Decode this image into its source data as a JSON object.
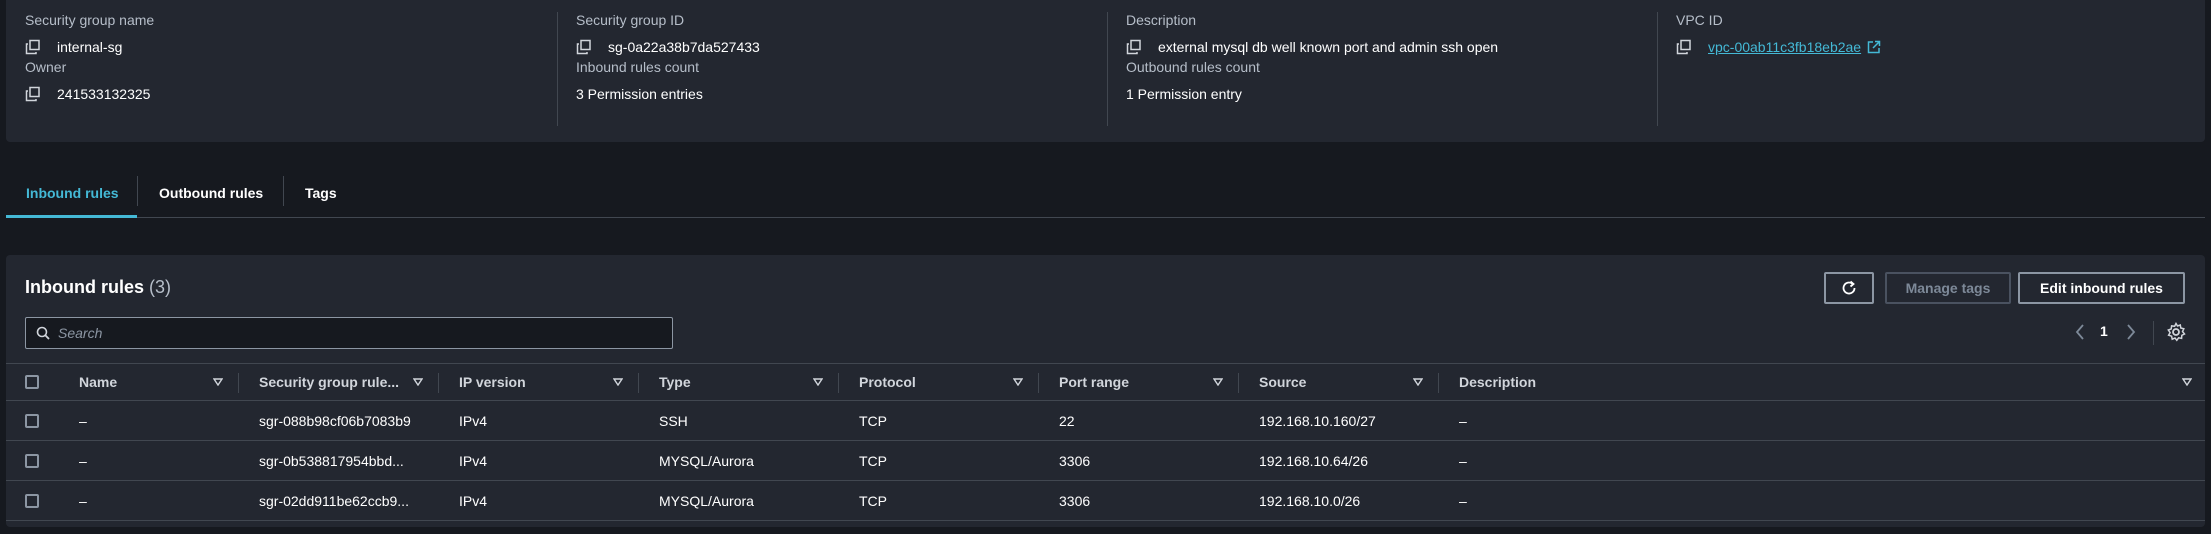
{
  "details": {
    "sg_name": {
      "label": "Security group name",
      "value": "internal-sg"
    },
    "sg_id": {
      "label": "Security group ID",
      "value": "sg-0a22a38b7da527433"
    },
    "description": {
      "label": "Description",
      "value": "external mysql db well known port and admin ssh open"
    },
    "vpc_id": {
      "label": "VPC ID",
      "value": "vpc-00ab11c3fb18eb2ae"
    },
    "owner": {
      "label": "Owner",
      "value": "241533132325"
    },
    "inbound_count": {
      "label": "Inbound rules count",
      "value": "3 Permission entries"
    },
    "outbound_count": {
      "label": "Outbound rules count",
      "value": "1 Permission entry"
    }
  },
  "tabs": {
    "inbound": "Inbound rules",
    "outbound": "Outbound rules",
    "tags": "Tags",
    "active": "inbound"
  },
  "table": {
    "title": "Inbound rules",
    "count": "(3)",
    "buttons": {
      "refresh": "refresh-icon",
      "manage_tags": "Manage tags",
      "edit": "Edit inbound rules"
    },
    "search_placeholder": "Search",
    "page": "1",
    "columns": {
      "name": "Name",
      "rule_id": "Security group rule...",
      "ip_version": "IP version",
      "type": "Type",
      "protocol": "Protocol",
      "port_range": "Port range",
      "source": "Source",
      "description": "Description"
    },
    "rows": [
      {
        "name": "–",
        "rule_id": "sgr-088b98cf06b7083b9",
        "ip_version": "IPv4",
        "type": "SSH",
        "protocol": "TCP",
        "port_range": "22",
        "source": "192.168.10.160/27",
        "description": "–"
      },
      {
        "name": "–",
        "rule_id": "sgr-0b538817954bbd...",
        "ip_version": "IPv4",
        "type": "MYSQL/Aurora",
        "protocol": "TCP",
        "port_range": "3306",
        "source": "192.168.10.64/26",
        "description": "–"
      },
      {
        "name": "–",
        "rule_id": "sgr-02dd911be62ccb9...",
        "ip_version": "IPv4",
        "type": "MYSQL/Aurora",
        "protocol": "TCP",
        "port_range": "3306",
        "source": "192.168.10.0/26",
        "description": "–"
      }
    ]
  },
  "colors": {
    "accent": "#44b9d6",
    "panel": "#232730",
    "background": "#16191f"
  }
}
